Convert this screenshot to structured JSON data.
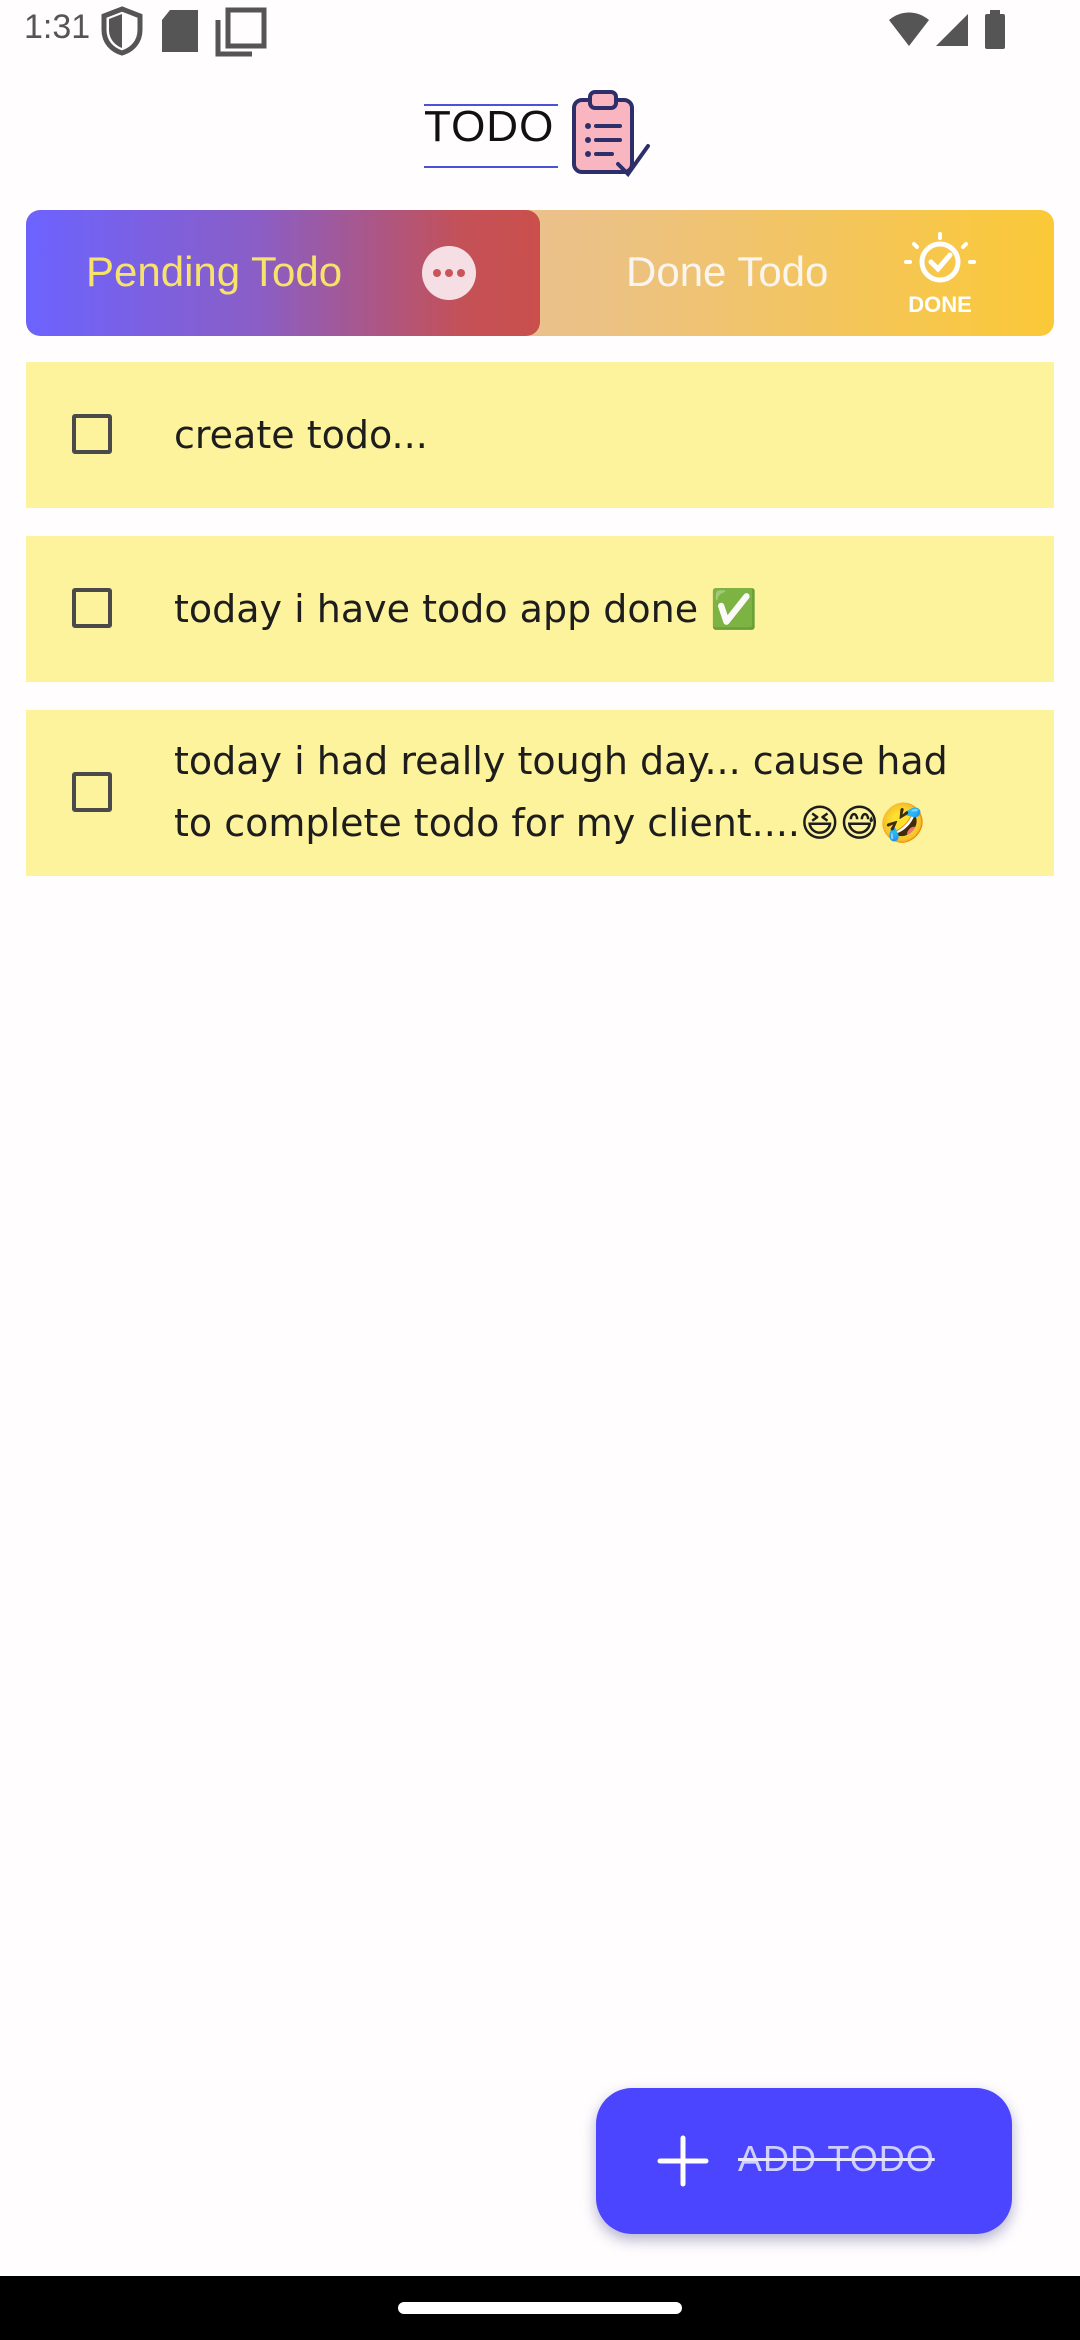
{
  "status_bar": {
    "time": "1:31",
    "left_icons": [
      "shield-icon",
      "sd-card-icon",
      "copy-icon"
    ],
    "right_icons": [
      "wifi-icon",
      "cell-signal-icon",
      "battery-icon"
    ]
  },
  "header": {
    "logo_text": "TODO",
    "logo_icon": "clipboard-list-icon"
  },
  "tabs": [
    {
      "label": "Pending Todo",
      "icon": "more-dots-icon",
      "active": true
    },
    {
      "label": "Done Todo",
      "icon": "done-badge-icon",
      "active": false
    }
  ],
  "todos": [
    {
      "text": "create todo...",
      "checked": false
    },
    {
      "text": "today i have  todo app done ✅",
      "checked": false
    },
    {
      "text": "today i had really tough day... cause had to complete todo for my client....😆😅🤣",
      "checked": false
    }
  ],
  "fab": {
    "label": "ADD TODO",
    "icon": "plus-icon"
  },
  "colors": {
    "accent": "#4b45ff",
    "todo_bg": "#fdf39d",
    "pending_tab_start": "#6c63ff",
    "pending_tab_end": "#ca4f4c",
    "done_tab_end": "#fbc937"
  }
}
